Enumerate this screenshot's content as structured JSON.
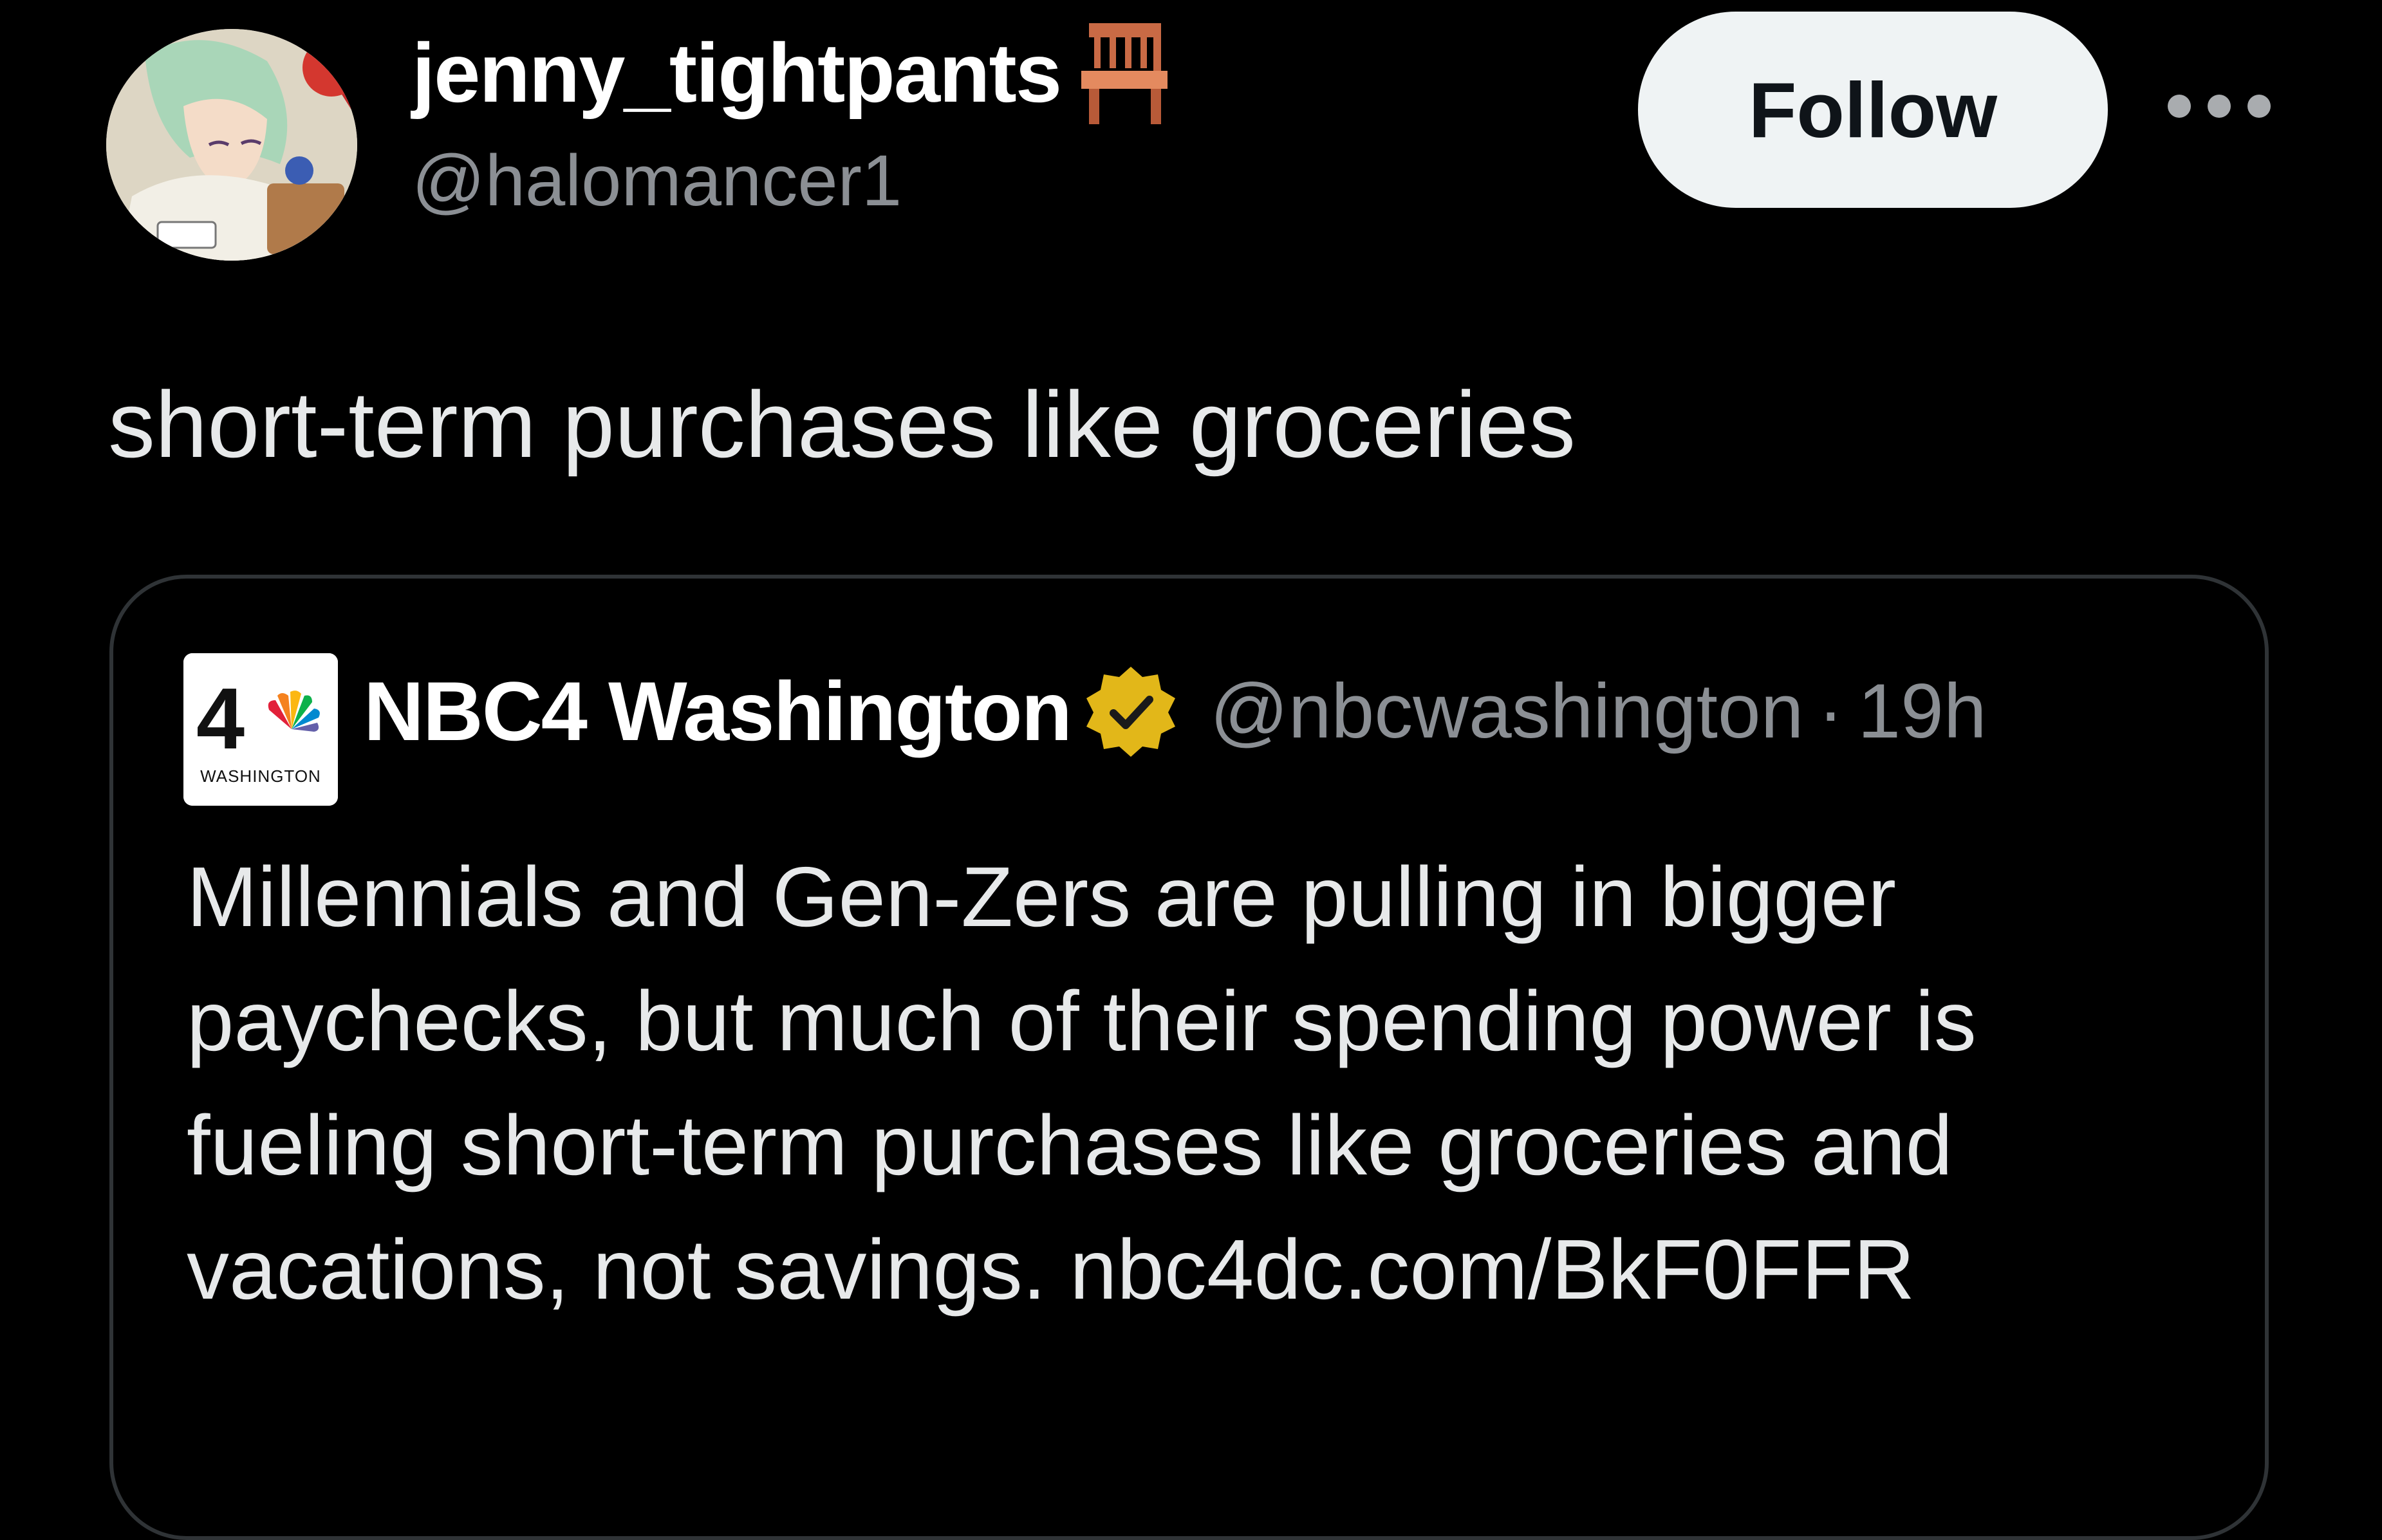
{
  "author": {
    "display_name": "jenny_tightpants",
    "name_emoji": "chair-emoji",
    "handle": "@halomancer1",
    "avatar": "anime-character-avatar"
  },
  "actions": {
    "follow_label": "Follow",
    "more_icon": "more-options-icon"
  },
  "tweet": {
    "text": "short-term purchases like groceries"
  },
  "quoted": {
    "logo": "nbc4-washington-logo",
    "logo_text_top": "4",
    "logo_text_bottom": "WASHINGTON",
    "name": "NBC4 Washington",
    "verified_icon": "verified-badge-icon",
    "verified_color": "#e2b719",
    "handle": "@nbcwashington",
    "separator": "·",
    "time": "19h",
    "text_lines": [
      "Millennials and Gen-Zers are pulling in bigger",
      "paychecks, but much of their spending power is",
      "fueling short-term purchases like groceries and",
      "vacations, not savings. nbc4dc.com/BkF0FFR"
    ]
  }
}
